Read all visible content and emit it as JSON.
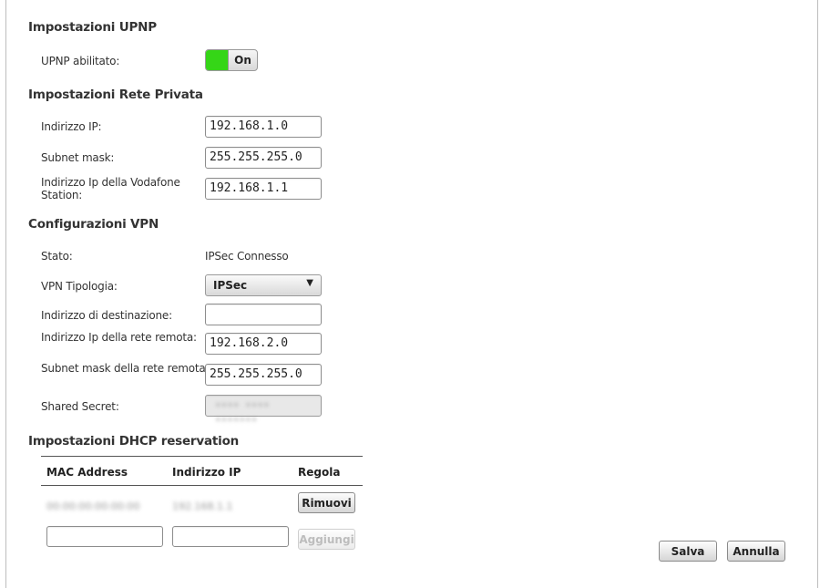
{
  "upnp": {
    "title": "Impostazioni UPNP",
    "enabled_label": "UPNP abilitato:",
    "toggle_state": "On",
    "toggle_color": "#35d617"
  },
  "lan": {
    "title": "Impostazioni Rete Privata",
    "ip_label": "Indirizzo IP:",
    "ip_value": "192.168.1.0",
    "subnet_label": "Subnet mask:",
    "subnet_value": "255.255.255.0",
    "station_ip_label_line1": "Indirizzo Ip della Vodafone",
    "station_ip_label_line2": "Station:",
    "station_ip_value": "192.168.1.1"
  },
  "vpn": {
    "title": "Configurazioni VPN",
    "status_label": "Stato:",
    "status_value": "IPSec Connesso",
    "type_label": "VPN Tipologia:",
    "type_value": "IPSec",
    "dest_label": "Indirizzo di destinazione:",
    "dest_value": "",
    "remote_ip_label": "Indirizzo Ip della rete remota:",
    "remote_ip_value": "192.168.2.0",
    "remote_subnet_label": "Subnet mask della rete remota:",
    "remote_subnet_value": "255.255.255.0",
    "secret_label": "Shared Secret:",
    "secret_value": "•••• •••• •••••••"
  },
  "dhcp": {
    "title": "Impostazioni DHCP reservation",
    "columns": [
      "MAC Address",
      "Indirizzo IP",
      "Regola"
    ],
    "row": {
      "mac": "00:00:00:00:00:00",
      "ip": "192.168.1.1",
      "action": "Rimuovi"
    },
    "new_mac_value": "",
    "new_ip_value": "",
    "add_label": "Aggiungi"
  },
  "actions": {
    "save": "Salva",
    "cancel": "Annulla"
  }
}
